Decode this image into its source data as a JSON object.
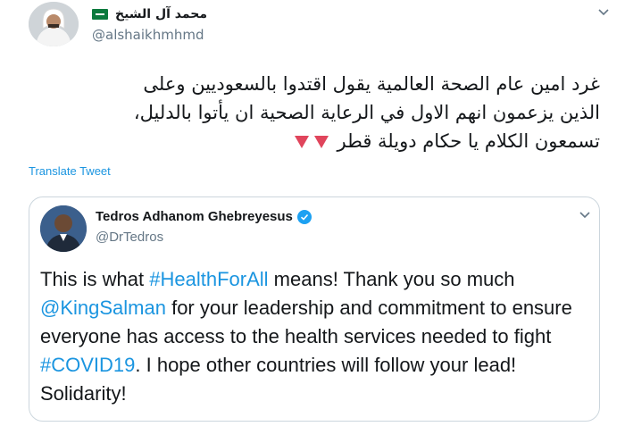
{
  "author": {
    "name": "محمد آل الشيخ",
    "handle": "@alshaikhmhmd"
  },
  "tweet": {
    "lines": [
      "غرد امين عام الصحة العالمية يقول اقتدوا بالسعوديين وعلى",
      "الذين يزعمون انهم الاول في الرعاية الصحية ان يأتوا بالدليل،",
      "تسمعون الكلام يا حكام دويلة قطر"
    ],
    "emoji": "red-triangle-down",
    "translate_label": "Translate Tweet"
  },
  "quoted": {
    "name": "Tedros Adhanom Ghebreyesus",
    "handle": "@DrTedros",
    "text": {
      "p1": "This is what ",
      "hashtag1": "#HealthForAll",
      "p2": " means! Thank you so much ",
      "mention": "@KingSalman",
      "p3": " for your leadership and commitment to ensure everyone has access to the health services needed to fight ",
      "hashtag2": "#COVID19",
      "p4": ". I hope other countries will follow your lead! Solidarity!"
    }
  },
  "colors": {
    "link": "#1b95e0",
    "secondary": "#657786",
    "border": "#ccd6dd",
    "verified": "#1da1f2",
    "triangle": "#e0455c"
  }
}
